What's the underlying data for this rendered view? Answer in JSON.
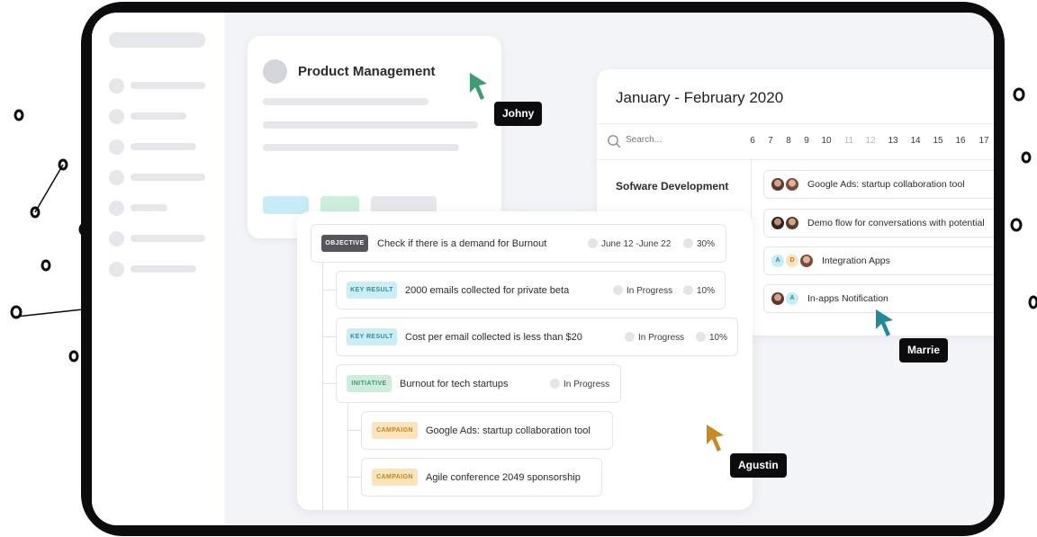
{
  "product_card": {
    "title": "Product Management"
  },
  "calendar": {
    "title": "January - February 2020",
    "search_placeholder": "Search...",
    "days": [
      "6",
      "7",
      "8",
      "9",
      "10",
      "11",
      "12",
      "13",
      "14",
      "15",
      "16",
      "17"
    ],
    "muted_days": [
      "11",
      "12"
    ],
    "section": "Sofware Development",
    "rows": [
      {
        "label": "Google Ads: startup collaboration tool",
        "avatars": [
          "photo",
          "photo2"
        ]
      },
      {
        "label": "Demo flow for conversations with potential",
        "avatars": [
          "photo3",
          "photo"
        ]
      },
      {
        "label": "Integration Apps",
        "avatars": [
          "A",
          "D",
          "photo2"
        ]
      },
      {
        "label": "In-apps Notification",
        "avatars": [
          "photo",
          "A"
        ]
      }
    ]
  },
  "okr": {
    "objective": {
      "tag": "OBJECTIVE",
      "label": "Check if there is a demand for Burnout",
      "date": "June 12 -June 22",
      "percent": "30%"
    },
    "key_results": [
      {
        "tag": "KEY RESULT",
        "label": "2000 emails collected for private beta",
        "status": "In Progress",
        "percent": "10%"
      },
      {
        "tag": "KEY RESULT",
        "label": "Cost per email collected is less than $20",
        "status": "In Progress",
        "percent": "10%"
      }
    ],
    "initiative": {
      "tag": "INITIATIVE",
      "label": "Burnout for tech startups",
      "status": "In Progress"
    },
    "campaigns": [
      {
        "tag": "CAMPAIGN",
        "label": "Google Ads: startup collaboration tool"
      },
      {
        "tag": "CAMPAIGN",
        "label": "Agile conference 2049 sponsorship"
      }
    ]
  },
  "cursors": [
    {
      "name": "Johny",
      "color": "#3e9b74"
    },
    {
      "name": "Marrie",
      "color": "#1f8a9c"
    },
    {
      "name": "Agustin",
      "color": "#c98a1e"
    }
  ]
}
